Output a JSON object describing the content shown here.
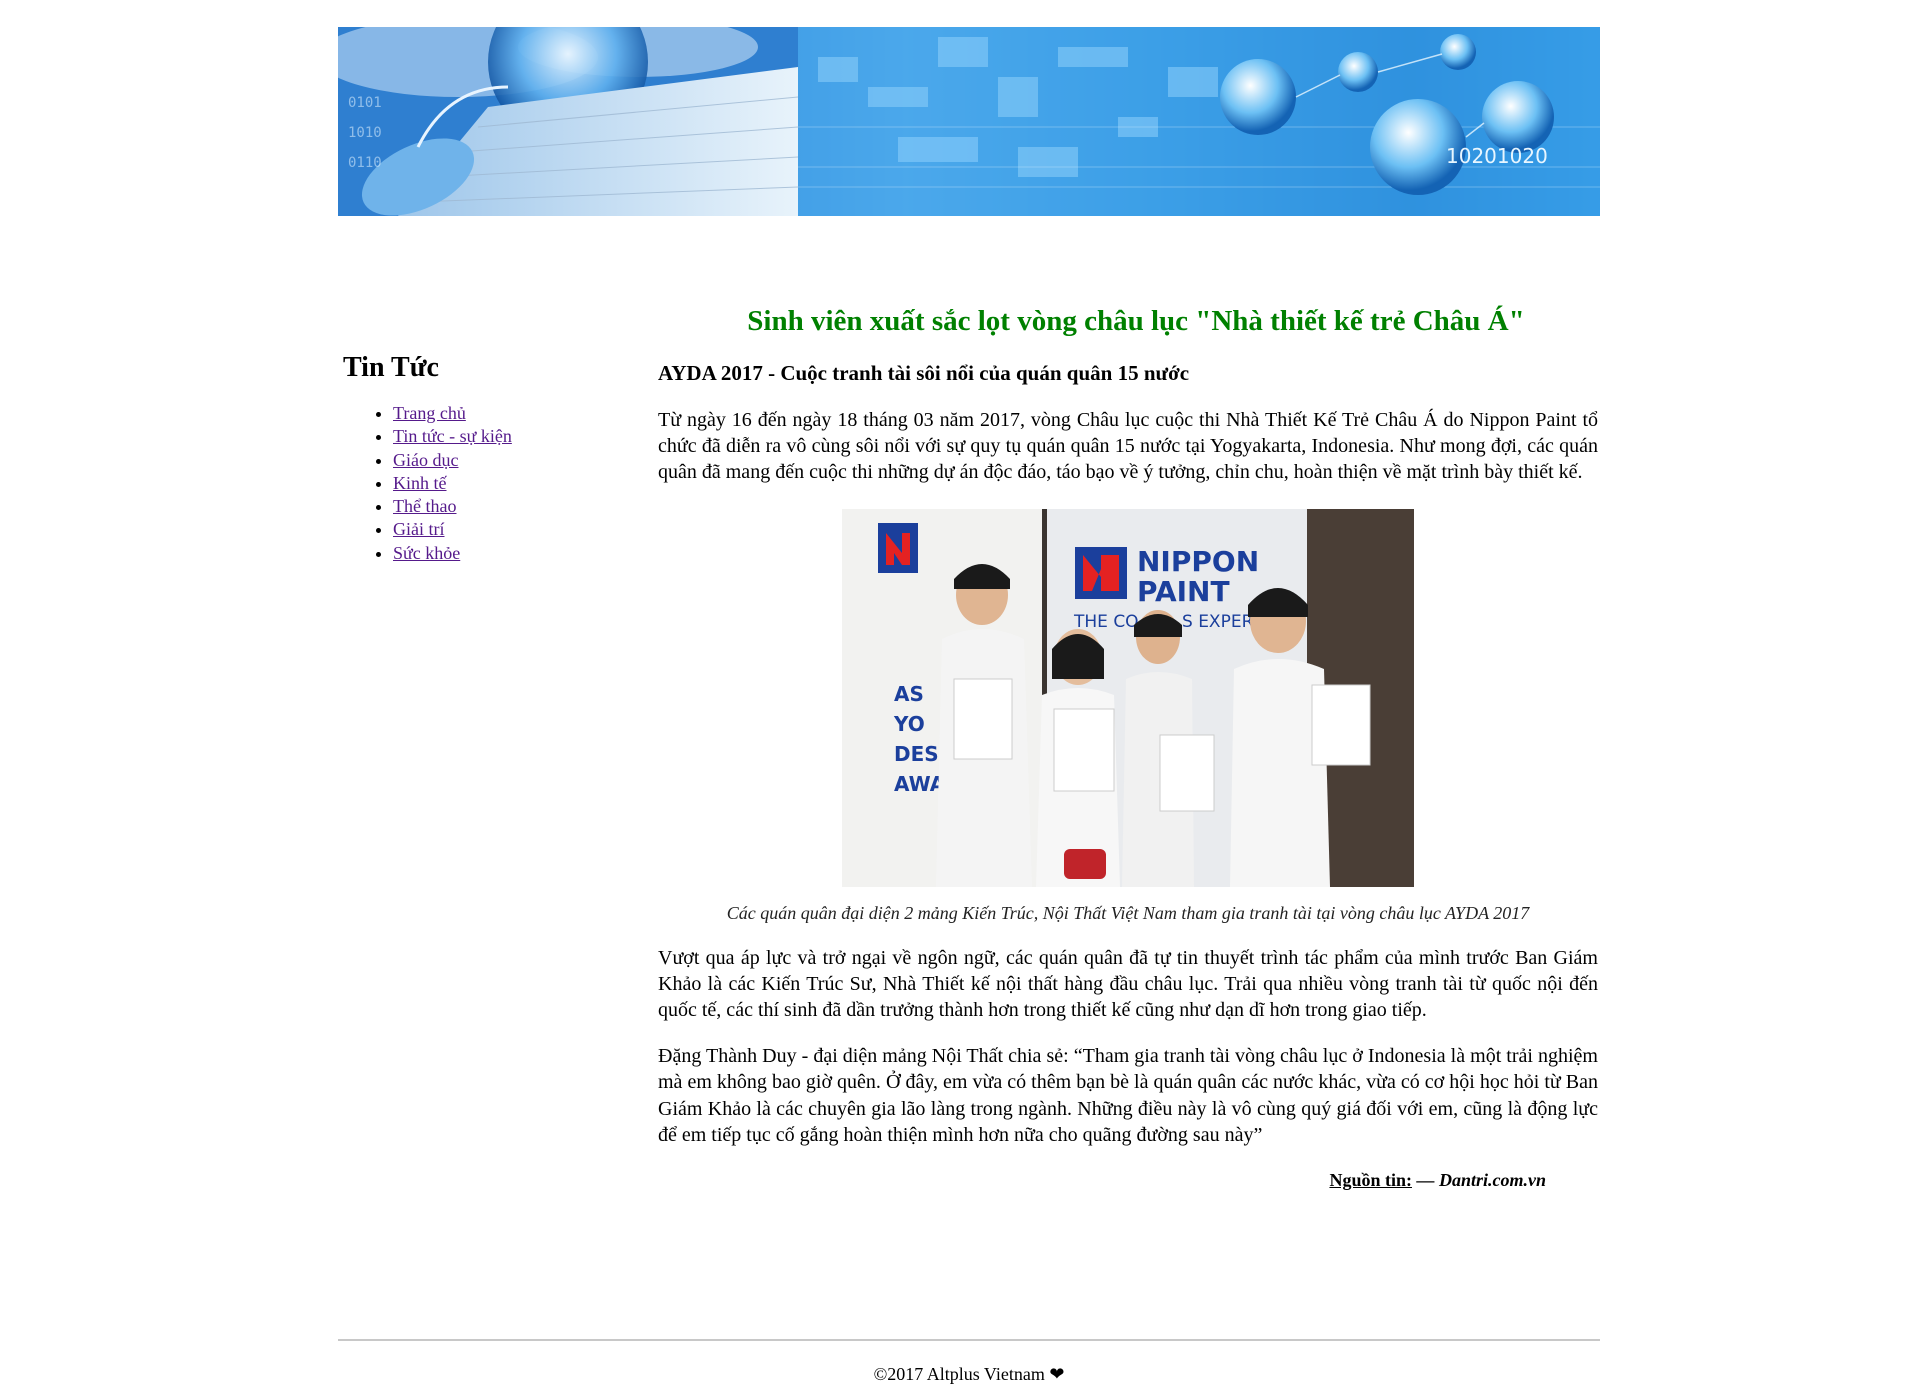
{
  "sidebar": {
    "title": "Tin Tức",
    "items": [
      {
        "label": "Trang chủ"
      },
      {
        "label": "Tin tức - sự kiện"
      },
      {
        "label": "Giáo dục"
      },
      {
        "label": "Kinh tế"
      },
      {
        "label": "Thể thao"
      },
      {
        "label": "Giải trí"
      },
      {
        "label": "Sức khỏe"
      }
    ]
  },
  "article": {
    "title": "Sinh viên xuất sắc lọt vòng châu lục \"Nhà thiết kế trẻ Châu Á\"",
    "subtitle": "AYDA 2017 - Cuộc tranh tài sôi nổi của quán quân 15 nước",
    "paragraph1": "Từ ngày 16 đến ngày 18 tháng 03 năm 2017, vòng Châu lục cuộc thi Nhà Thiết Kế Trẻ Châu Á do Nippon Paint tổ chức đã diễn ra vô cùng sôi nổi với sự quy tụ quán quân 15 nước tại Yogyakarta, Indonesia. Như mong đợi, các quán quân đã mang đến cuộc thi những dự án độc đáo, táo bạo về ý tưởng, chỉn chu, hoàn thiện về mặt trình bày thiết kế.",
    "caption": "Các quán quân đại diện 2 mảng Kiến Trúc, Nội Thất Việt Nam tham gia tranh tài tại vòng châu lục AYDA 2017",
    "paragraph2": "Vượt qua áp lực và trở ngại về ngôn ngữ, các quán quân đã tự tin thuyết trình tác phẩm của mình trước Ban Giám Khảo là các Kiến Trúc Sư, Nhà Thiết kế nội thất hàng đầu châu lục. Trải qua nhiều vòng tranh tài từ quốc nội đến quốc tế, các thí sinh đã dần trưởng thành hơn trong thiết kế cũng như dạn dĩ hơn trong giao tiếp.",
    "paragraph3": "Đặng Thành Duy - đại diện mảng Nội Thất chia sẻ: “Tham gia tranh tài vòng châu lục ở Indonesia là một trải nghiệm mà em không bao giờ quên. Ở đây, em vừa có thêm bạn bè là quán quân các nước khác, vừa có cơ hội học hỏi từ Ban Giám Khảo là các chuyên gia lão làng trong ngành. Những điều này là vô cùng quý giá đối với em, cũng là động lực để em tiếp tục cố gắng hoàn thiện mình hơn nữa cho quãng đường sau này”",
    "source_label": "Nguồn tin:",
    "source_value": " — Dantri.com.vn"
  },
  "photo": {
    "banner_left_text": "NIPPON",
    "banner_right_text": "PAINT",
    "banner_tagline": "THE CO",
    "banner_tagline2": "S EXPER",
    "letters": [
      "AS",
      "YO",
      "DES",
      "AWA"
    ]
  },
  "banner": {
    "digits": "10201020"
  },
  "footer": {
    "text": "©2017 Altplus Vietnam ❤"
  },
  "colors": {
    "title_green": "#008000",
    "link_visited": "#551a8b"
  }
}
